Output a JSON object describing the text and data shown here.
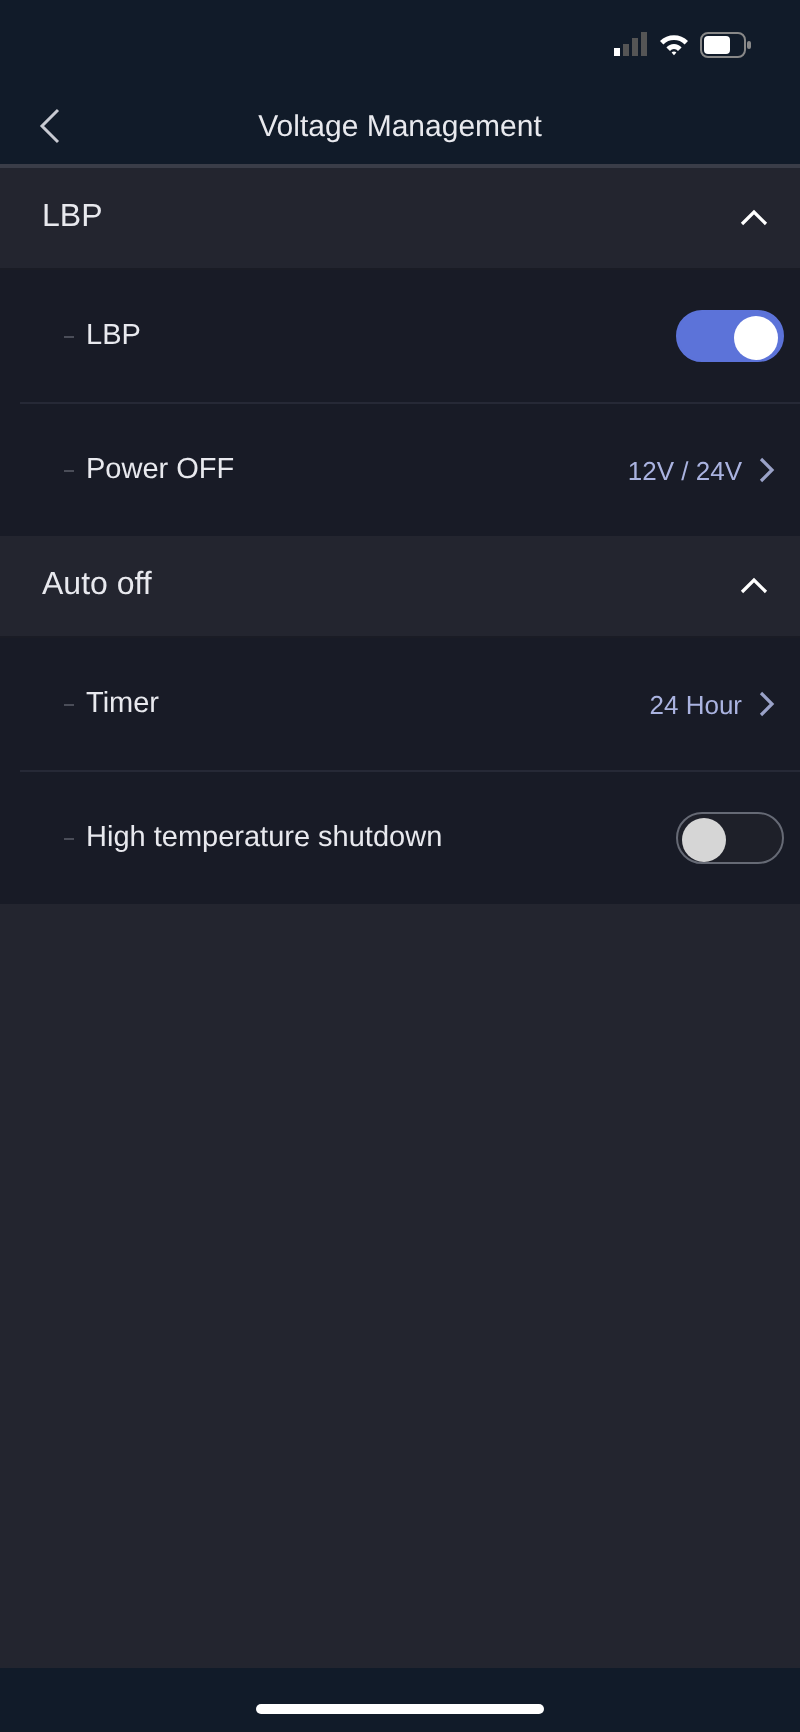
{
  "nav_bar": {
    "title": "Voltage Management"
  },
  "sections": [
    {
      "title": "LBP",
      "expanded": true,
      "rows": [
        {
          "kind": "toggle",
          "label": "LBP",
          "on": true
        },
        {
          "kind": "value",
          "label": "Power OFF",
          "value": "12V / 24V"
        }
      ]
    },
    {
      "title": "Auto off",
      "expanded": true,
      "rows": [
        {
          "kind": "value",
          "label": "Timer",
          "value": "24 Hour"
        },
        {
          "kind": "toggle",
          "label": "High temperature shutdown",
          "on": false
        }
      ]
    }
  ]
}
